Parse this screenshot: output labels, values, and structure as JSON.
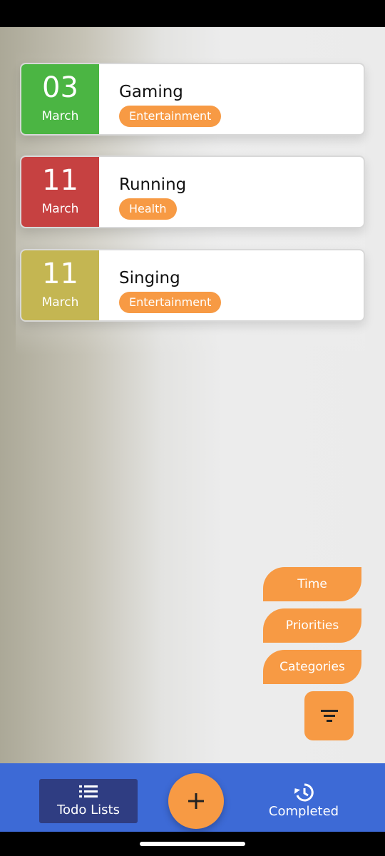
{
  "todos": [
    {
      "day": "03",
      "month": "March",
      "title": "Gaming",
      "category": "Entertainment",
      "date_color": "#4bb543"
    },
    {
      "day": "11",
      "month": "March",
      "title": "Running",
      "category": "Health",
      "date_color": "#c64141"
    },
    {
      "day": "11",
      "month": "March",
      "title": "Singing",
      "category": "Entertainment",
      "date_color": "#c4b652"
    }
  ],
  "sort_options": [
    "Time",
    "Priorities",
    "Categories"
  ],
  "filter_icon": "filter-icon",
  "add_icon": "plus-icon",
  "nav": {
    "todo_label": "Todo Lists",
    "todo_icon": "list-icon",
    "completed_label": "Completed",
    "completed_icon": "history-icon"
  },
  "colors": {
    "accent": "#f79a44",
    "nav_bar": "#3d6ad6",
    "nav_active": "#2f3d82"
  }
}
